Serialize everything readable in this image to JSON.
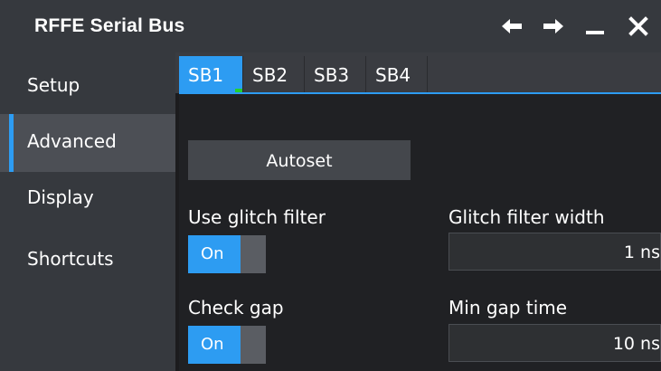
{
  "window": {
    "title": "RFFE Serial Bus"
  },
  "titlebar_icons": [
    "back-arrow-icon",
    "forward-arrow-icon",
    "minimize-icon",
    "close-icon"
  ],
  "sidebar": {
    "items": [
      {
        "label": "Setup",
        "active": false
      },
      {
        "label": "Advanced",
        "active": true
      },
      {
        "label": "Display",
        "active": false
      },
      {
        "label": "Shortcuts",
        "active": false
      }
    ]
  },
  "tabs": [
    {
      "label": "SB1",
      "active": true,
      "indicator_color": "#23d12f"
    },
    {
      "label": "SB2",
      "active": false
    },
    {
      "label": "SB3",
      "active": false
    },
    {
      "label": "SB4",
      "active": false
    }
  ],
  "advanced": {
    "autoset_label": "Autoset",
    "glitch_filter": {
      "label": "Use glitch filter",
      "toggle_label": "On",
      "enabled": true
    },
    "glitch_width": {
      "label": "Glitch filter width",
      "value": "1 ns"
    },
    "check_gap": {
      "label": "Check gap",
      "toggle_label": "On",
      "enabled": true
    },
    "min_gap": {
      "label": "Min gap time",
      "value": "10 ns"
    }
  },
  "colors": {
    "accent": "#2d9cf2",
    "titlebar": "#36393e",
    "indicator": "#23d12f"
  }
}
